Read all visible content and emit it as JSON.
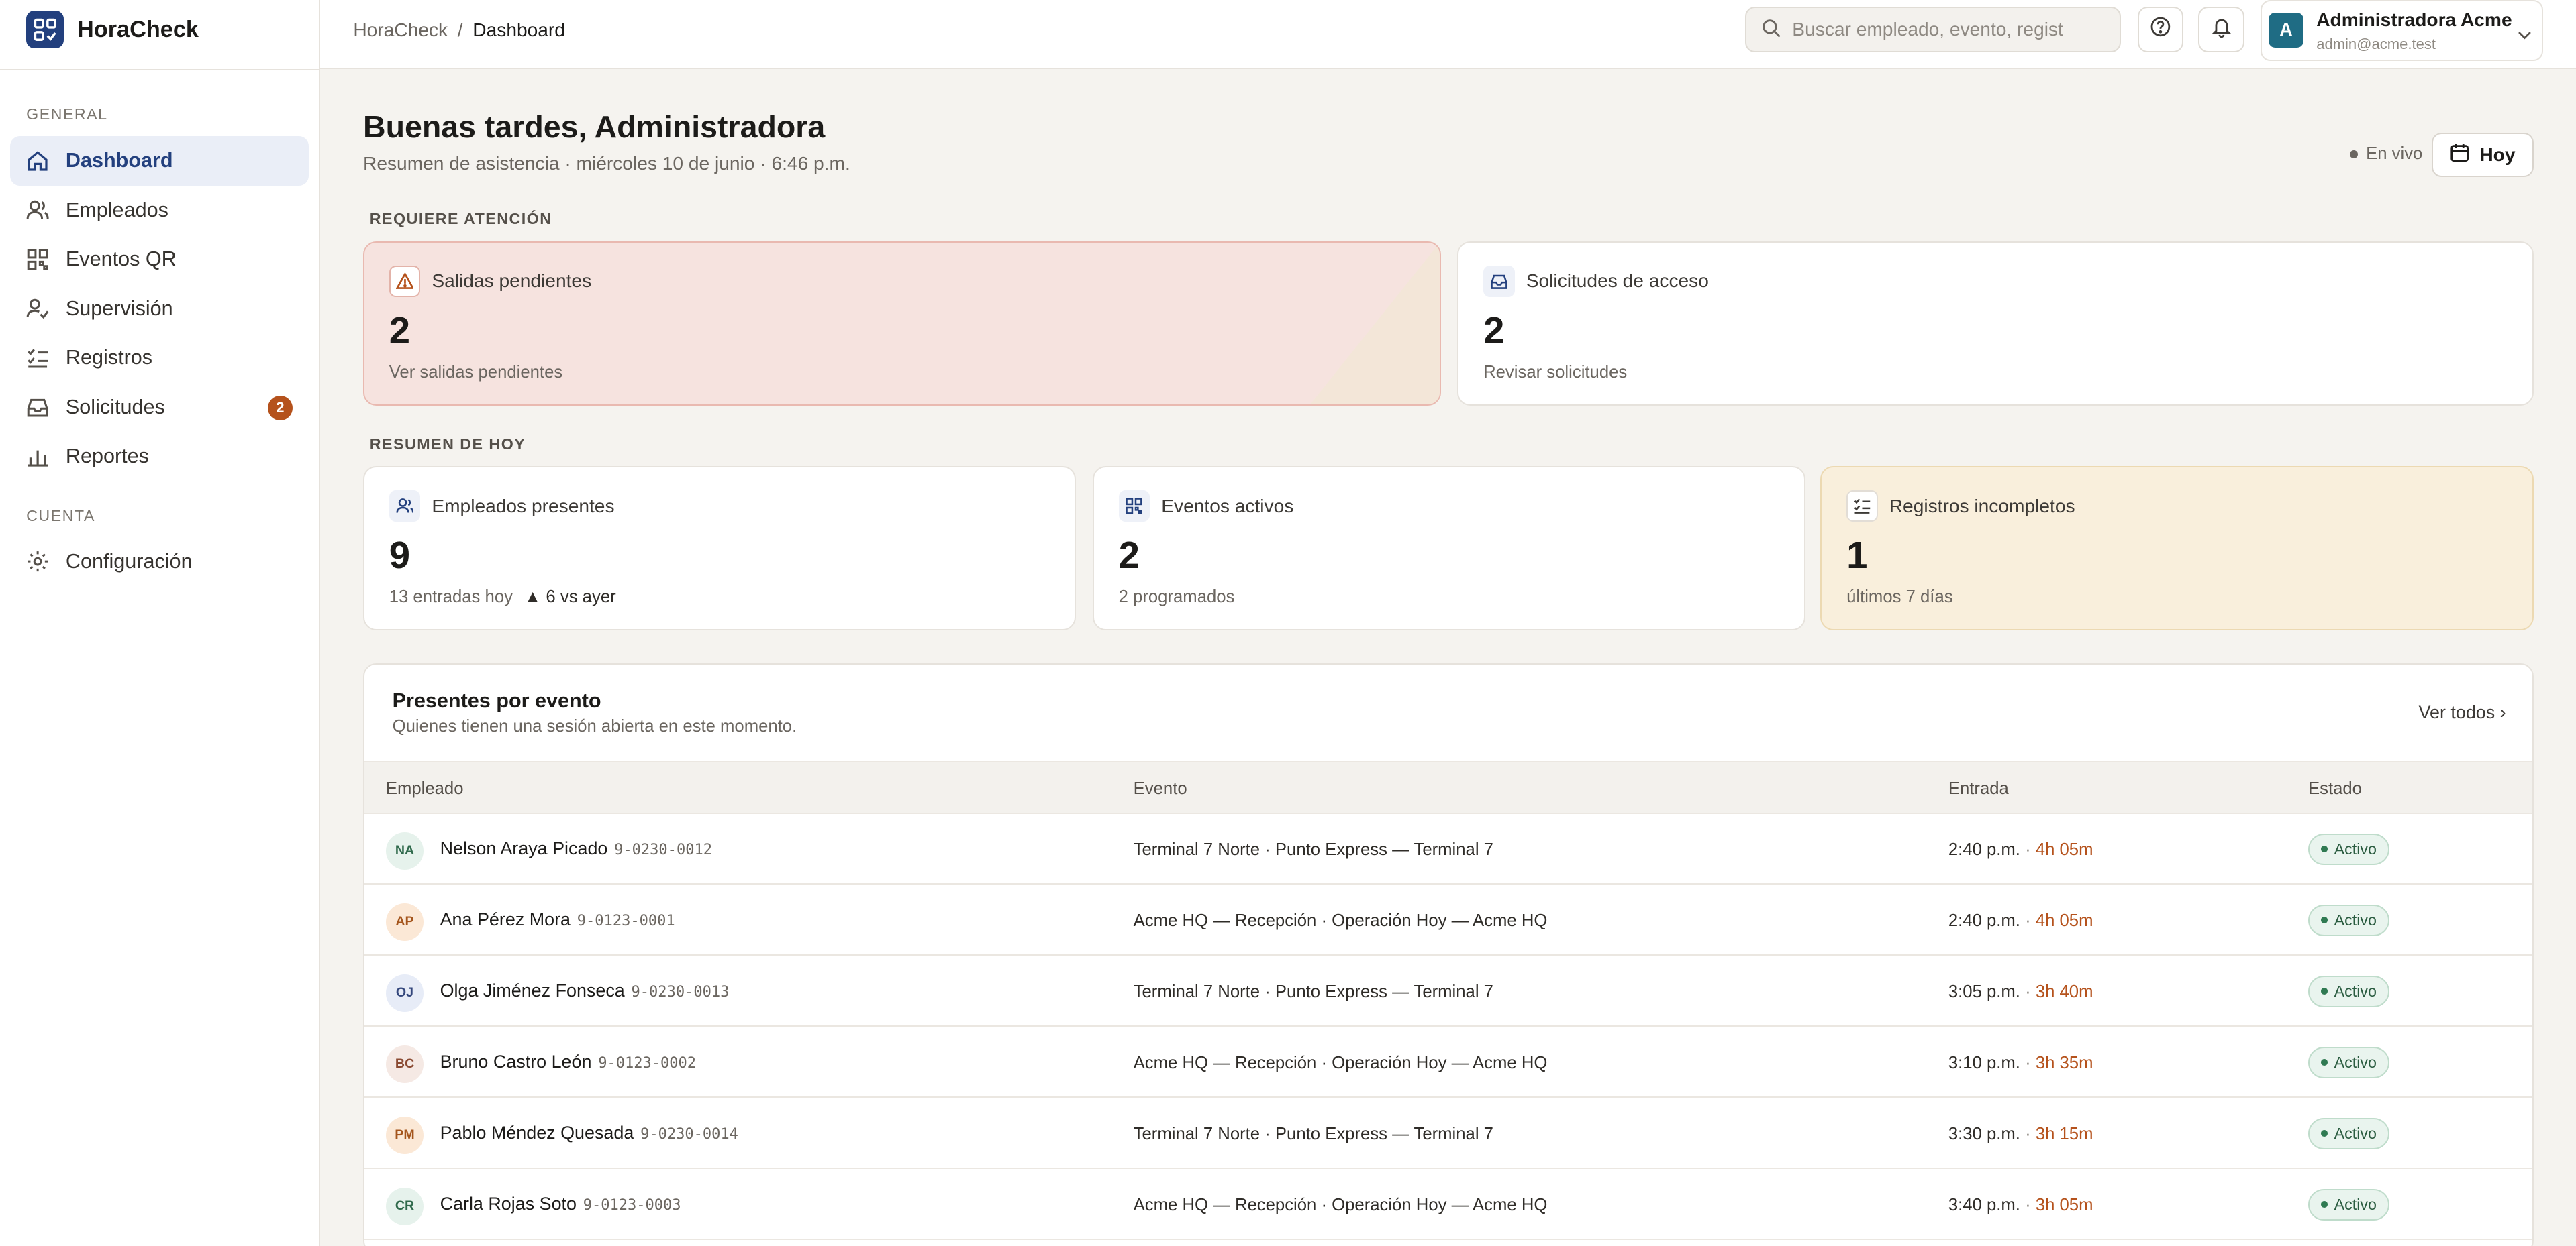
{
  "brand": {
    "name": "HoraCheck"
  },
  "sidebar": {
    "section_general": "GENERAL",
    "section_account": "CUENTA",
    "items": [
      {
        "label": "Dashboard",
        "icon": "home-icon"
      },
      {
        "label": "Empleados",
        "icon": "users-icon"
      },
      {
        "label": "Eventos QR",
        "icon": "qr-grid-icon"
      },
      {
        "label": "Supervisión",
        "icon": "user-check-icon"
      },
      {
        "label": "Registros",
        "icon": "list-check-icon"
      },
      {
        "label": "Solicitudes",
        "icon": "inbox-icon",
        "badge": "2"
      },
      {
        "label": "Reportes",
        "icon": "bar-chart-icon"
      },
      {
        "label": "Configuración",
        "icon": "gear-icon"
      }
    ]
  },
  "topbar": {
    "breadcrumb_root": "HoraCheck",
    "breadcrumb_sep": "/",
    "breadcrumb_current": "Dashboard",
    "search_placeholder": "Buscar empleado, evento, regist",
    "user_initial": "A",
    "user_name": "Administradora Acme",
    "user_email": "admin@acme.test"
  },
  "header": {
    "greeting": "Buenas tardes, Administradora",
    "subtitle": "Resumen de asistencia · miércoles 10 de junio · 6:46 p.m.",
    "live_label": "En vivo",
    "today_label": "Hoy"
  },
  "attention": {
    "label": "REQUIERE ATENCIÓN",
    "cards": [
      {
        "title": "Salidas pendientes",
        "value": "2",
        "footer": "Ver salidas pendientes"
      },
      {
        "title": "Solicitudes de acceso",
        "value": "2",
        "footer": "Revisar solicitudes"
      }
    ]
  },
  "summary": {
    "label": "RESUMEN DE HOY",
    "cards": [
      {
        "title": "Empleados presentes",
        "value": "9",
        "footer": "13 entradas hoy",
        "delta": "▲ 6 vs ayer"
      },
      {
        "title": "Eventos activos",
        "value": "2",
        "footer": "2 programados"
      },
      {
        "title": "Registros incompletos",
        "value": "1",
        "footer": "últimos 7 días"
      }
    ]
  },
  "presence": {
    "title": "Presentes por evento",
    "subtitle": "Quienes tienen una sesión abierta en este momento.",
    "link": "Ver todos ›",
    "columns": [
      "Empleado",
      "Evento",
      "Entrada",
      "Estado"
    ],
    "rows": [
      {
        "initials": "NA",
        "name": "Nelson Araya Picado",
        "id": "9-0230-0012",
        "event": "Terminal 7 Norte · Punto Express — Terminal 7",
        "time": "2:40 p.m.",
        "duration": "4h 05m",
        "status": "Activo",
        "color": "#e6f2ec",
        "fg": "#2f6a4c"
      },
      {
        "initials": "AP",
        "name": "Ana Pérez Mora",
        "id": "9-0123-0001",
        "event": "Acme HQ — Recepción · Operación Hoy — Acme HQ",
        "time": "2:40 p.m.",
        "duration": "4h 05m",
        "status": "Activo",
        "color": "#fbe8d6",
        "fg": "#a4551c"
      },
      {
        "initials": "OJ",
        "name": "Olga Jiménez Fonseca",
        "id": "9-0230-0013",
        "event": "Terminal 7 Norte · Punto Express — Terminal 7",
        "time": "3:05 p.m.",
        "duration": "3h 40m",
        "status": "Activo",
        "color": "#e7ecf7",
        "fg": "#34477c"
      },
      {
        "initials": "BC",
        "name": "Bruno Castro León",
        "id": "9-0123-0002",
        "event": "Acme HQ — Recepción · Operación Hoy — Acme HQ",
        "time": "3:10 p.m.",
        "duration": "3h 35m",
        "status": "Activo",
        "color": "#f5e9e4",
        "fg": "#8a4a32"
      },
      {
        "initials": "PM",
        "name": "Pablo Méndez Quesada",
        "id": "9-0230-0014",
        "event": "Terminal 7 Norte · Punto Express — Terminal 7",
        "time": "3:30 p.m.",
        "duration": "3h 15m",
        "status": "Activo",
        "color": "#fbe8d6",
        "fg": "#a4551c"
      },
      {
        "initials": "CR",
        "name": "Carla Rojas Soto",
        "id": "9-0123-0003",
        "event": "Acme HQ — Recepción · Operación Hoy — Acme HQ",
        "time": "3:40 p.m.",
        "duration": "3h 05m",
        "status": "Activo",
        "color": "#e6f2ec",
        "fg": "#2f6a4c"
      }
    ]
  },
  "colors": {
    "accent": "#23407e",
    "alert_bg": "#f6e3df",
    "warn_bg": "#f9efdc",
    "active": "#2f7a52",
    "duration": "#b5521c"
  }
}
